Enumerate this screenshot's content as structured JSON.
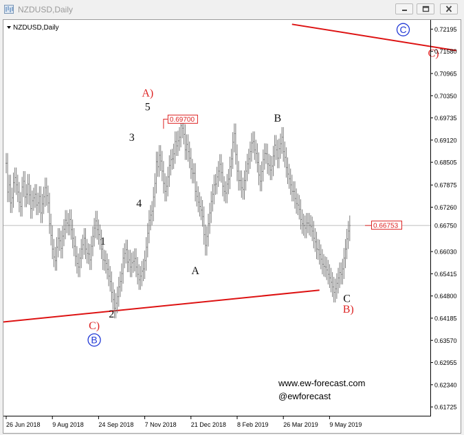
{
  "window": {
    "title": "NZDUSD,Daily",
    "icons": {
      "app": "chart-window-icon",
      "minimize": "minimize-icon",
      "restore": "restore-icon",
      "close": "close-icon"
    }
  },
  "chart_data": {
    "type": "line",
    "symbol_label": "NZDUSD,Daily",
    "ylim": [
      0.6148,
      0.7245
    ],
    "grid": false,
    "y_ticks": [
      "0.72195",
      "0.71580",
      "0.70965",
      "0.70350",
      "0.69735",
      "0.69120",
      "0.68505",
      "0.67875",
      "0.67260",
      "0.66750",
      "0.66030",
      "0.65415",
      "0.64800",
      "0.64185",
      "0.63570",
      "0.62955",
      "0.62340",
      "0.61725"
    ],
    "x_ticks": [
      "26 Jun 2018",
      "9 Aug 2018",
      "24 Sep 2018",
      "7 Nov 2018",
      "21 Dec 2018",
      "8 Feb 2019",
      "26 Mar 2019",
      "9 May 2019"
    ],
    "x_tick_index": [
      0,
      32,
      64,
      96,
      128,
      160,
      192,
      224
    ],
    "series": [
      {
        "values": [
          0.6848,
          0.6768,
          0.6788,
          0.6738,
          0.6752,
          0.6794,
          0.6808,
          0.6788,
          0.6768,
          0.674,
          0.6728,
          0.6782,
          0.6798,
          0.6754,
          0.6762,
          0.679,
          0.676,
          0.6722,
          0.6744,
          0.6752,
          0.6762,
          0.6732,
          0.6738,
          0.6756,
          0.671,
          0.6735,
          0.6755,
          0.678,
          0.6758,
          0.6738,
          0.668,
          0.6648,
          0.661,
          0.6588,
          0.6578,
          0.6615,
          0.664,
          0.6633,
          0.6612,
          0.6646,
          0.6665,
          0.669,
          0.6682,
          0.6676,
          0.6692,
          0.6664,
          0.664,
          0.6618,
          0.659,
          0.657,
          0.656,
          0.6585,
          0.661,
          0.6622,
          0.664,
          0.661,
          0.6598,
          0.6596,
          0.658,
          0.6618,
          0.6645,
          0.6668,
          0.6688,
          0.6664,
          0.665,
          0.6636,
          0.661,
          0.658,
          0.6578,
          0.657,
          0.6554,
          0.6535,
          0.652,
          0.649,
          0.647,
          0.6446,
          0.646,
          0.6478,
          0.6505,
          0.652,
          0.6542,
          0.6585,
          0.6598,
          0.6608,
          0.6574,
          0.658,
          0.656,
          0.6572,
          0.6576,
          0.6584,
          0.656,
          0.654,
          0.6525,
          0.6535,
          0.6549,
          0.6555,
          0.6578,
          0.6615,
          0.6654,
          0.669,
          0.6704,
          0.6715,
          0.6754,
          0.6792,
          0.6852,
          0.6838,
          0.687,
          0.6854,
          0.6826,
          0.6792,
          0.677,
          0.6784,
          0.681,
          0.6842,
          0.6858,
          0.686,
          0.6874,
          0.6908,
          0.6896,
          0.691,
          0.692,
          0.6952,
          0.6945,
          0.6928,
          0.6885,
          0.69,
          0.688,
          0.6862,
          0.6832,
          0.682,
          0.682,
          0.677,
          0.6756,
          0.674,
          0.6728,
          0.6718,
          0.67,
          0.665,
          0.662,
          0.6645,
          0.668,
          0.671,
          0.6742,
          0.6762,
          0.6788,
          0.679,
          0.681,
          0.6826,
          0.6845,
          0.6822,
          0.6784,
          0.677,
          0.6765,
          0.679,
          0.6804,
          0.6838,
          0.686,
          0.6906,
          0.693,
          0.6872,
          0.6826,
          0.68,
          0.68,
          0.678,
          0.6775,
          0.68,
          0.6826,
          0.6846,
          0.686,
          0.688,
          0.6904,
          0.6908,
          0.6885,
          0.6875,
          0.685,
          0.6815,
          0.6798,
          0.6825,
          0.6858,
          0.6875,
          0.6874,
          0.6846,
          0.6842,
          0.6829,
          0.684,
          0.6868,
          0.6898,
          0.6885,
          0.6862,
          0.6888,
          0.6902,
          0.692,
          0.688,
          0.6864,
          0.6836,
          0.6818,
          0.6805,
          0.6788,
          0.677,
          0.677,
          0.675,
          0.6736,
          0.6732,
          0.672,
          0.6692,
          0.668,
          0.6675,
          0.6668,
          0.6682,
          0.6682,
          0.6676,
          0.6672,
          0.666,
          0.664,
          0.663,
          0.661,
          0.6608,
          0.6595,
          0.6582,
          0.6568,
          0.6562,
          0.656,
          0.6552,
          0.654,
          0.653,
          0.6518,
          0.6505,
          0.649,
          0.65,
          0.6515,
          0.653,
          0.6545,
          0.654,
          0.6555,
          0.6585,
          0.661,
          0.6638,
          0.666,
          0.6675
        ]
      }
    ],
    "current_price_label": "0.66753",
    "current_price": 0.66753,
    "high_label": "0.69700",
    "high_price": 0.697,
    "watermark": [
      "www.ew-forecast.com",
      "@ewforecast"
    ],
    "wave_labels": [
      {
        "text": "A)",
        "color": "#dd2222",
        "bar": 98,
        "price": 0.7033
      },
      {
        "text": "5",
        "color": "#111111",
        "bar": 98,
        "price": 0.6995
      },
      {
        "text": "3",
        "color": "#111111",
        "bar": 87,
        "price": 0.691
      },
      {
        "text": "4",
        "color": "#111111",
        "bar": 92,
        "price": 0.6727
      },
      {
        "text": "1",
        "color": "#111111",
        "bar": 67,
        "price": 0.6622
      },
      {
        "text": "2",
        "color": "#111111",
        "bar": 73,
        "price": 0.642
      },
      {
        "text": "A",
        "color": "#111111",
        "bar": 131,
        "price": 0.654
      },
      {
        "text": "B",
        "color": "#111111",
        "bar": 188,
        "price": 0.6963
      },
      {
        "text": "C",
        "color": "#111111",
        "bar": 236,
        "price": 0.6463
      },
      {
        "text": "B)",
        "color": "#dd2222",
        "bar": 237,
        "price": 0.6434
      },
      {
        "text": "C)",
        "color": "#dd2222",
        "bar": 61,
        "price": 0.6388
      },
      {
        "text": "C)",
        "color": "#dd2222",
        "bar": 296,
        "price": 0.7143
      }
    ],
    "circled_labels": [
      {
        "text": "B",
        "color": "#1f37d6",
        "bar": 61,
        "price": 0.6358
      },
      {
        "text": "C",
        "color": "#1f37d6",
        "bar": 275,
        "price": 0.7218
      }
    ],
    "trendlines": [
      {
        "from": [
          -2,
          0.6408
        ],
        "to": [
          217,
          0.6496
        ],
        "color": "#dd1111"
      },
      {
        "from": [
          198,
          0.7233
        ],
        "to": [
          312,
          0.716
        ],
        "color": "#dd1111"
      }
    ],
    "colors": {
      "bars": "#7a7a7a",
      "trend": "#dd1111",
      "price_tag": "#dd2222",
      "wave_red": "#dd2222",
      "wave_blue": "#1f37d6",
      "axis": "#000000"
    }
  }
}
